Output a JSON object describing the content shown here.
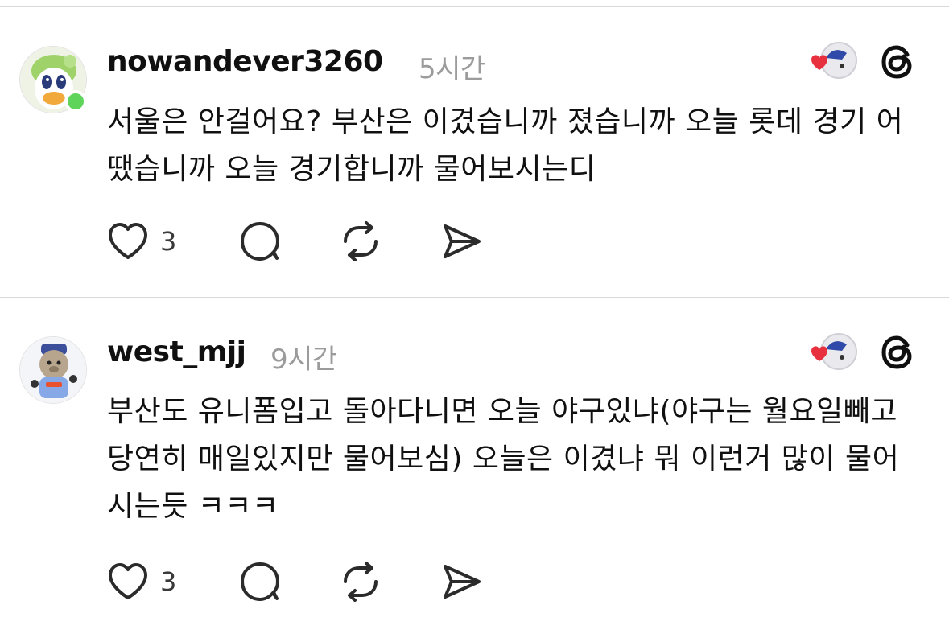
{
  "posts": [
    {
      "username": "nowandever3260",
      "time": "5시간",
      "text": "서울은 안걸어요? 부산은 이겼습니까 졌습니까 오늘 롯데 경기 어땠습니까 오늘 경기합니까 물어보시는디",
      "likes": "3",
      "online": true,
      "icons": {
        "avatar": "duck-mascot-avatar",
        "badge": "heart-mascot-badge-icon",
        "app": "threads-icon",
        "like": "heart-icon",
        "reply": "comment-icon",
        "repost": "repost-icon",
        "share": "send-icon"
      }
    },
    {
      "username": "west_mjj",
      "time": "9시간",
      "text": "부산도 유니폼입고 돌아다니면 오늘 야구있냐(야구는 월요일빼고 당연히 매일있지만 물어보심) 오늘은 이겼냐 뭐 이런거 많이 물어시는듯 ㅋㅋㅋ",
      "likes": "3",
      "online": false,
      "icons": {
        "avatar": "bear-mascot-avatar",
        "badge": "heart-mascot-badge-icon",
        "app": "threads-icon",
        "like": "heart-icon",
        "reply": "comment-icon",
        "repost": "repost-icon",
        "share": "send-icon"
      }
    }
  ],
  "colors": {
    "username": "#101010",
    "time": "#9b9b9b",
    "divider": "#d9d9d9",
    "online": "#5fd45a",
    "heart_badge": "#e8313f"
  }
}
